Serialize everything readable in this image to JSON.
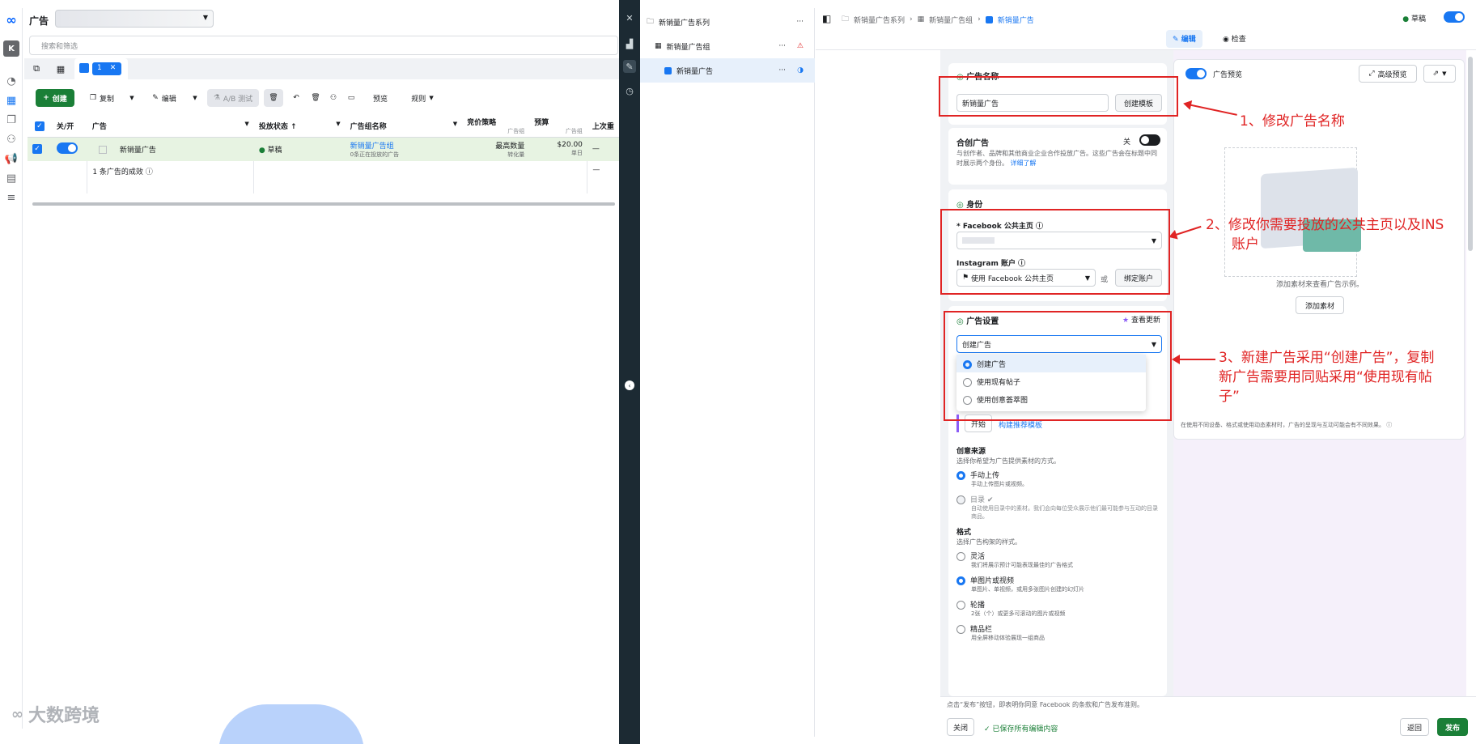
{
  "nav": {
    "meta_logo": "∞",
    "account_initial": "K"
  },
  "header": {
    "title": "广告",
    "search_placeholder": "搜索和筛选"
  },
  "tabs": {
    "active_count": "1"
  },
  "toolbar": {
    "create": "创建",
    "copy": "复制",
    "edit": "编辑",
    "ab_test": "A/B 测试",
    "preview": "预览",
    "rules": "规则"
  },
  "table": {
    "headers": [
      "关/开",
      "广告",
      "投放状态 ↑",
      "广告组名称",
      "竞价策略",
      "预算",
      "上次重"
    ],
    "sub_headers": {
      "bid": "广告组",
      "budget": "广告组"
    },
    "row": {
      "name": "新销量广告",
      "status": "草稿",
      "adset_name": "新销量广告组",
      "adset_sub": "0条正在投放的广告",
      "bid": "最高数量",
      "bid_sub": "转化量",
      "budget": "$20.00",
      "budget_sub": "单日",
      "last": "—"
    },
    "summary": "1 条广告的成效",
    "summary_last": "—"
  },
  "tree": {
    "campaign": "新销量广告系列",
    "adset": "新销量广告组",
    "ad": "新销量广告"
  },
  "breadcrumb": {
    "campaign": "新销量广告系列",
    "adset": "新销量广告组",
    "ad": "新销量广告",
    "draft": "草稿"
  },
  "editor_tabs": {
    "edit": "编辑",
    "review": "检查"
  },
  "ad_name": {
    "title": "广告名称",
    "value": "新销量广告",
    "template_btn": "创建模板"
  },
  "collab": {
    "title": "合创广告",
    "toggle_label": "关",
    "desc": "与创作者、品牌和其他商业企业合作投放广告。这些广告会在标题中同时展示两个身份。",
    "learn_more": "详细了解"
  },
  "identity": {
    "title": "身份",
    "fb_page_label": "* Facebook 公共主页",
    "ig_label": "Instagram 账户",
    "ig_value": "使用 Facebook 公共主页",
    "or": "或",
    "connect_btn": "绑定账户"
  },
  "ad_setup": {
    "title": "广告设置",
    "whats_new": "查看更新",
    "selected": "创建广告",
    "options": [
      "创建广告",
      "使用现有帖子",
      "使用创意荟萃图"
    ],
    "start_btn": "开始",
    "template_link": "构建推荐模板"
  },
  "creative_source": {
    "title": "创意来源",
    "desc": "选择你希望为广告提供素材的方式。",
    "options": [
      {
        "label": "手动上传",
        "sub": "手动上传图片或视频。"
      },
      {
        "label": "目录 ✔",
        "sub": "自动使用目录中的素材。我们会向每位受众展示他们最可能参与互动的目录商品。"
      }
    ]
  },
  "format": {
    "title": "格式",
    "desc": "选择广告构架的样式。",
    "options": [
      {
        "label": "灵活",
        "sub": "我们将展示预计可能表现最佳的广告格式"
      },
      {
        "label": "单图片或视频",
        "sub": "单图片、单视频，或用多张图片创建的幻灯片"
      },
      {
        "label": "轮播",
        "sub": "2张（个）或更多可滚动的图片或视频"
      },
      {
        "label": "精品栏",
        "sub": "用全屏移动体验展现一组商品"
      }
    ]
  },
  "preview": {
    "label": "广告预览",
    "advanced_btn": "高级预览",
    "empty_text": "添加素材来查看广告示例。",
    "add_btn": "添加素材",
    "footnote": "在使用不同设备、格式或使用动态素材时，广告的呈现与互动可能会有不同效果。"
  },
  "footer": {
    "terms": "点击“发布”按钮，即表明你同意 Facebook 的条款和广告发布准则。",
    "close": "关闭",
    "saved": "✓ 已保存所有编辑内容",
    "back": "返回",
    "publish": "发布"
  },
  "annotations": {
    "a1": "1、修改广告名称",
    "a2_l1": "2、修改你需要投放的公共主页以及INS",
    "a2_l2": "账户",
    "a3_l1": "3、新建广告采用“创建广告”，复制",
    "a3_l2": "新广告需要用同贴采用“使用现有帖",
    "a3_l3": "子”"
  },
  "watermark": "大数跨境",
  "colors": {
    "accent": "#1877f2",
    "create_green": "#1a7f37",
    "annotation_red": "#e02424",
    "divider_dark": "#1c2a33"
  }
}
